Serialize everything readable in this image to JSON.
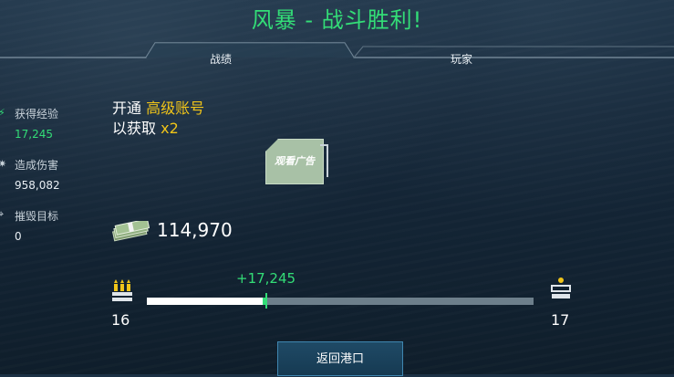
{
  "title": "风暴 - 战斗胜利!",
  "tabs": [
    {
      "label": "战绩",
      "active": true
    },
    {
      "label": "玩家",
      "active": false
    }
  ],
  "stats": {
    "xp": {
      "label": "获得经验",
      "value": "17,245",
      "color": "#33dd77"
    },
    "damage": {
      "label": "造成伤害",
      "value": "958,082"
    },
    "destroyed": {
      "label": "摧毁目标",
      "value": "0"
    }
  },
  "promo": {
    "line1_prefix": "开通 ",
    "line1_highlight": "高级账号",
    "line2_prefix": "以获取 ",
    "line2_highlight": "x2",
    "ad_button_label": "观看广告"
  },
  "credits": {
    "value": "114,970",
    "icon": "cash-stack-icon"
  },
  "progress": {
    "gain_label": "+17,245",
    "fraction_before": 0.3,
    "fraction_after": 0.31,
    "current_level": "16",
    "next_level": "17"
  },
  "actions": {
    "return_label": "返回港口"
  },
  "colors": {
    "accent_green": "#33dd77",
    "gold": "#f0c419",
    "button_blue": "#1f4a66"
  }
}
